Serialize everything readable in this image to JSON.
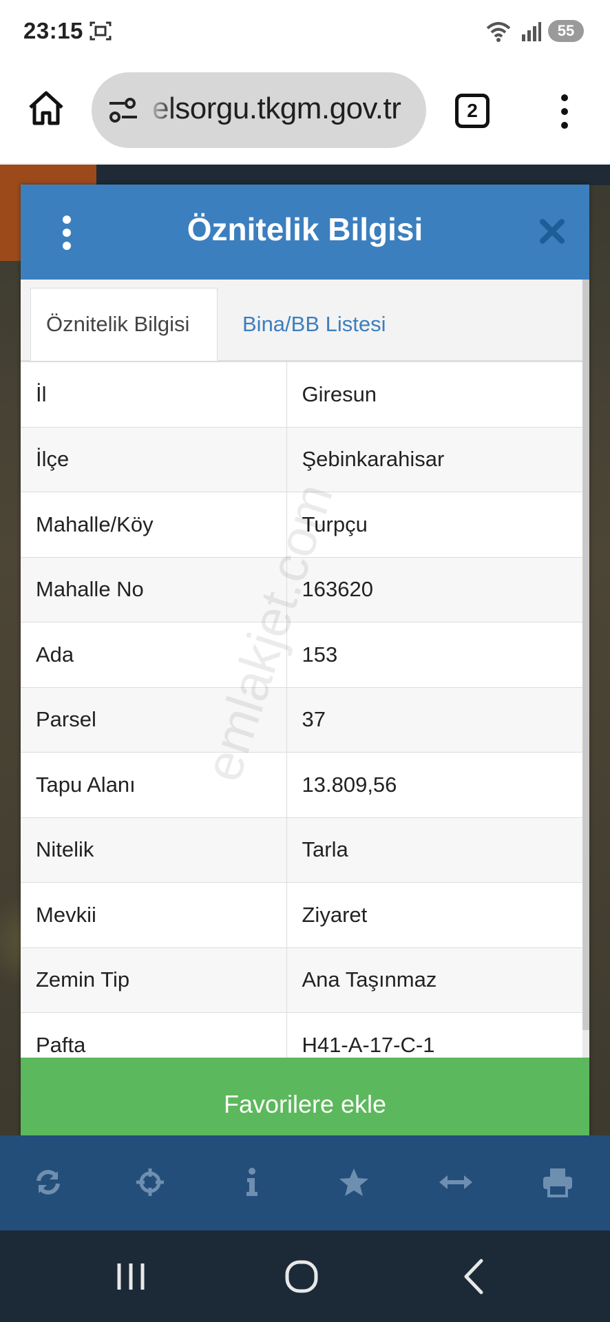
{
  "status": {
    "time": "23:15",
    "battery": "55"
  },
  "browser": {
    "url": "elsorgu.tkgm.gov.tr",
    "tab_count": "2"
  },
  "modal": {
    "title": "Öznitelik Bilgisi",
    "tabs": [
      {
        "label": "Öznitelik Bilgisi",
        "active": true
      },
      {
        "label": "Bina/BB Listesi",
        "active": false
      }
    ],
    "rows": [
      {
        "key": "İl",
        "value": "Giresun"
      },
      {
        "key": "İlçe",
        "value": "Şebinkarahisar"
      },
      {
        "key": "Mahalle/Köy",
        "value": "Turpçu"
      },
      {
        "key": "Mahalle No",
        "value": "163620"
      },
      {
        "key": "Ada",
        "value": "153"
      },
      {
        "key": "Parsel",
        "value": "37"
      },
      {
        "key": "Tapu Alanı",
        "value": "13.809,56"
      },
      {
        "key": "Nitelik",
        "value": "Tarla"
      },
      {
        "key": "Mevkii",
        "value": "Ziyaret"
      },
      {
        "key": "Zemin Tip",
        "value": "Ana Taşınmaz"
      },
      {
        "key": "Pafta",
        "value": "H41-A-17-C-1"
      }
    ],
    "favorite_button": "Favorilere ekle"
  },
  "watermark": "emlakjet.com",
  "toolbar_icons": [
    "refresh-icon",
    "crosshair-icon",
    "info-icon",
    "star-icon",
    "arrows-horizontal-icon",
    "printer-icon"
  ],
  "colors": {
    "header_blue": "#3c7fbe",
    "button_green": "#5cb85c",
    "toolbar_blue": "#234e7a",
    "navbar": "#1c2a38"
  }
}
